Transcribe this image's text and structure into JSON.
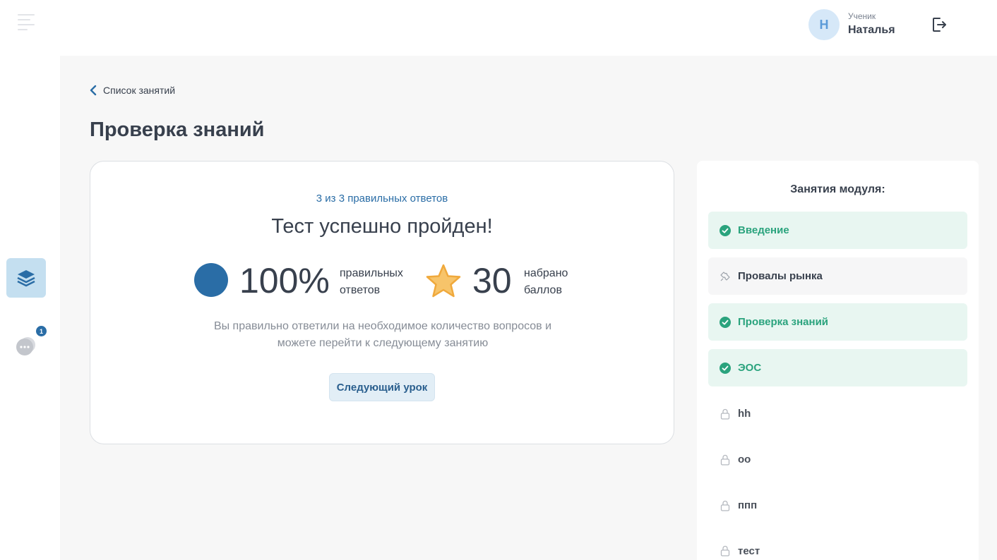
{
  "user": {
    "initial": "Н",
    "role": "Ученик",
    "name": "Наталья"
  },
  "chat": {
    "badge": "1"
  },
  "breadcrumb": {
    "back_label": "Список занятий"
  },
  "page": {
    "title": "Проверка знаний"
  },
  "result": {
    "count_text": "3 из 3 правильных ответов",
    "title": "Тест успешно пройден!",
    "percent": "100%",
    "percent_label": "правильных ответов",
    "score": "30",
    "score_label": "набрано баллов",
    "description": "Вы правильно ответили на необходимое количество вопросов и можете перейти к следующему занятию",
    "next_button": "Следующий урок"
  },
  "module": {
    "title": "Занятия модуля:",
    "lessons": [
      {
        "label": "Введение",
        "status": "done"
      },
      {
        "label": "Провалы рынка",
        "status": "current"
      },
      {
        "label": "Проверка знаний",
        "status": "done"
      },
      {
        "label": "ЭОС",
        "status": "done"
      },
      {
        "label": "hh",
        "status": "locked"
      },
      {
        "label": "оо",
        "status": "locked"
      },
      {
        "label": "ппп",
        "status": "locked"
      },
      {
        "label": "тест",
        "status": "locked"
      }
    ]
  },
  "colors": {
    "accent": "#2a6da6",
    "success": "#2aa37d",
    "success_bg": "#e8f6f1",
    "star": "#f7c46a"
  },
  "icons": {
    "menu": "burger-menu-icon",
    "courses": "layers-icon",
    "chat": "chat-bubble-icon",
    "logout": "logout-icon",
    "back": "chevron-left-icon",
    "pie": "pie-chart-icon",
    "star": "star-icon",
    "done": "check-circle-icon",
    "current": "puzzle-icon",
    "locked": "lock-icon"
  }
}
